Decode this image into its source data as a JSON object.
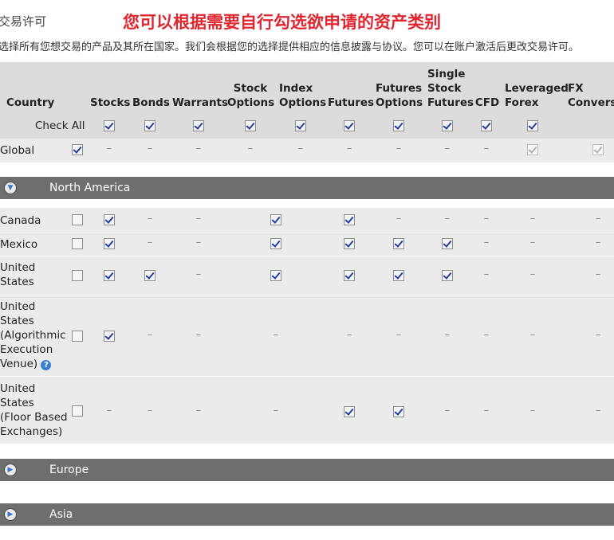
{
  "section_label": "交易许可",
  "headline": "您可以根据需要自行勾选欲申请的资产类别",
  "intro": "选择所有您想交易的产品及其所在国家。我们会根据您的选择提供相应的信息披露与协议。您可以在账户激活后更改交易许可。",
  "columns": {
    "country": "Country",
    "stocks": "Stocks",
    "bonds": "Bonds",
    "warrants": "Warrants",
    "stock_options": [
      "Stock",
      "Options"
    ],
    "index_options": [
      "Index",
      "Options"
    ],
    "futures": "Futures",
    "futures_options": [
      "Futures",
      "Options"
    ],
    "single_stock_futures": [
      "Single",
      "Stock",
      "Futures"
    ],
    "cfd": "CFD",
    "leveraged_forex": [
      "Leveraged",
      "Forex"
    ],
    "fx_convers": [
      "FX",
      "Convers"
    ]
  },
  "check_all_label": "Check All",
  "dash": "–",
  "rows": {
    "global": "Global",
    "canada": "Canada",
    "mexico": "Mexico",
    "us": [
      "United",
      "States"
    ],
    "us_algo": [
      "United",
      "States",
      "(Algorithmic",
      "Execution",
      "Venue)"
    ],
    "us_floor": [
      "United",
      "States",
      "(Floor Based",
      "Exchanges)"
    ]
  },
  "help_icon_text": "?",
  "regions": {
    "north_america": "North America",
    "europe": "Europe",
    "asia": "Asia"
  },
  "icons": {
    "expanded": "chevron-down-circle-icon",
    "collapsed": "chevron-right-circle-icon"
  }
}
